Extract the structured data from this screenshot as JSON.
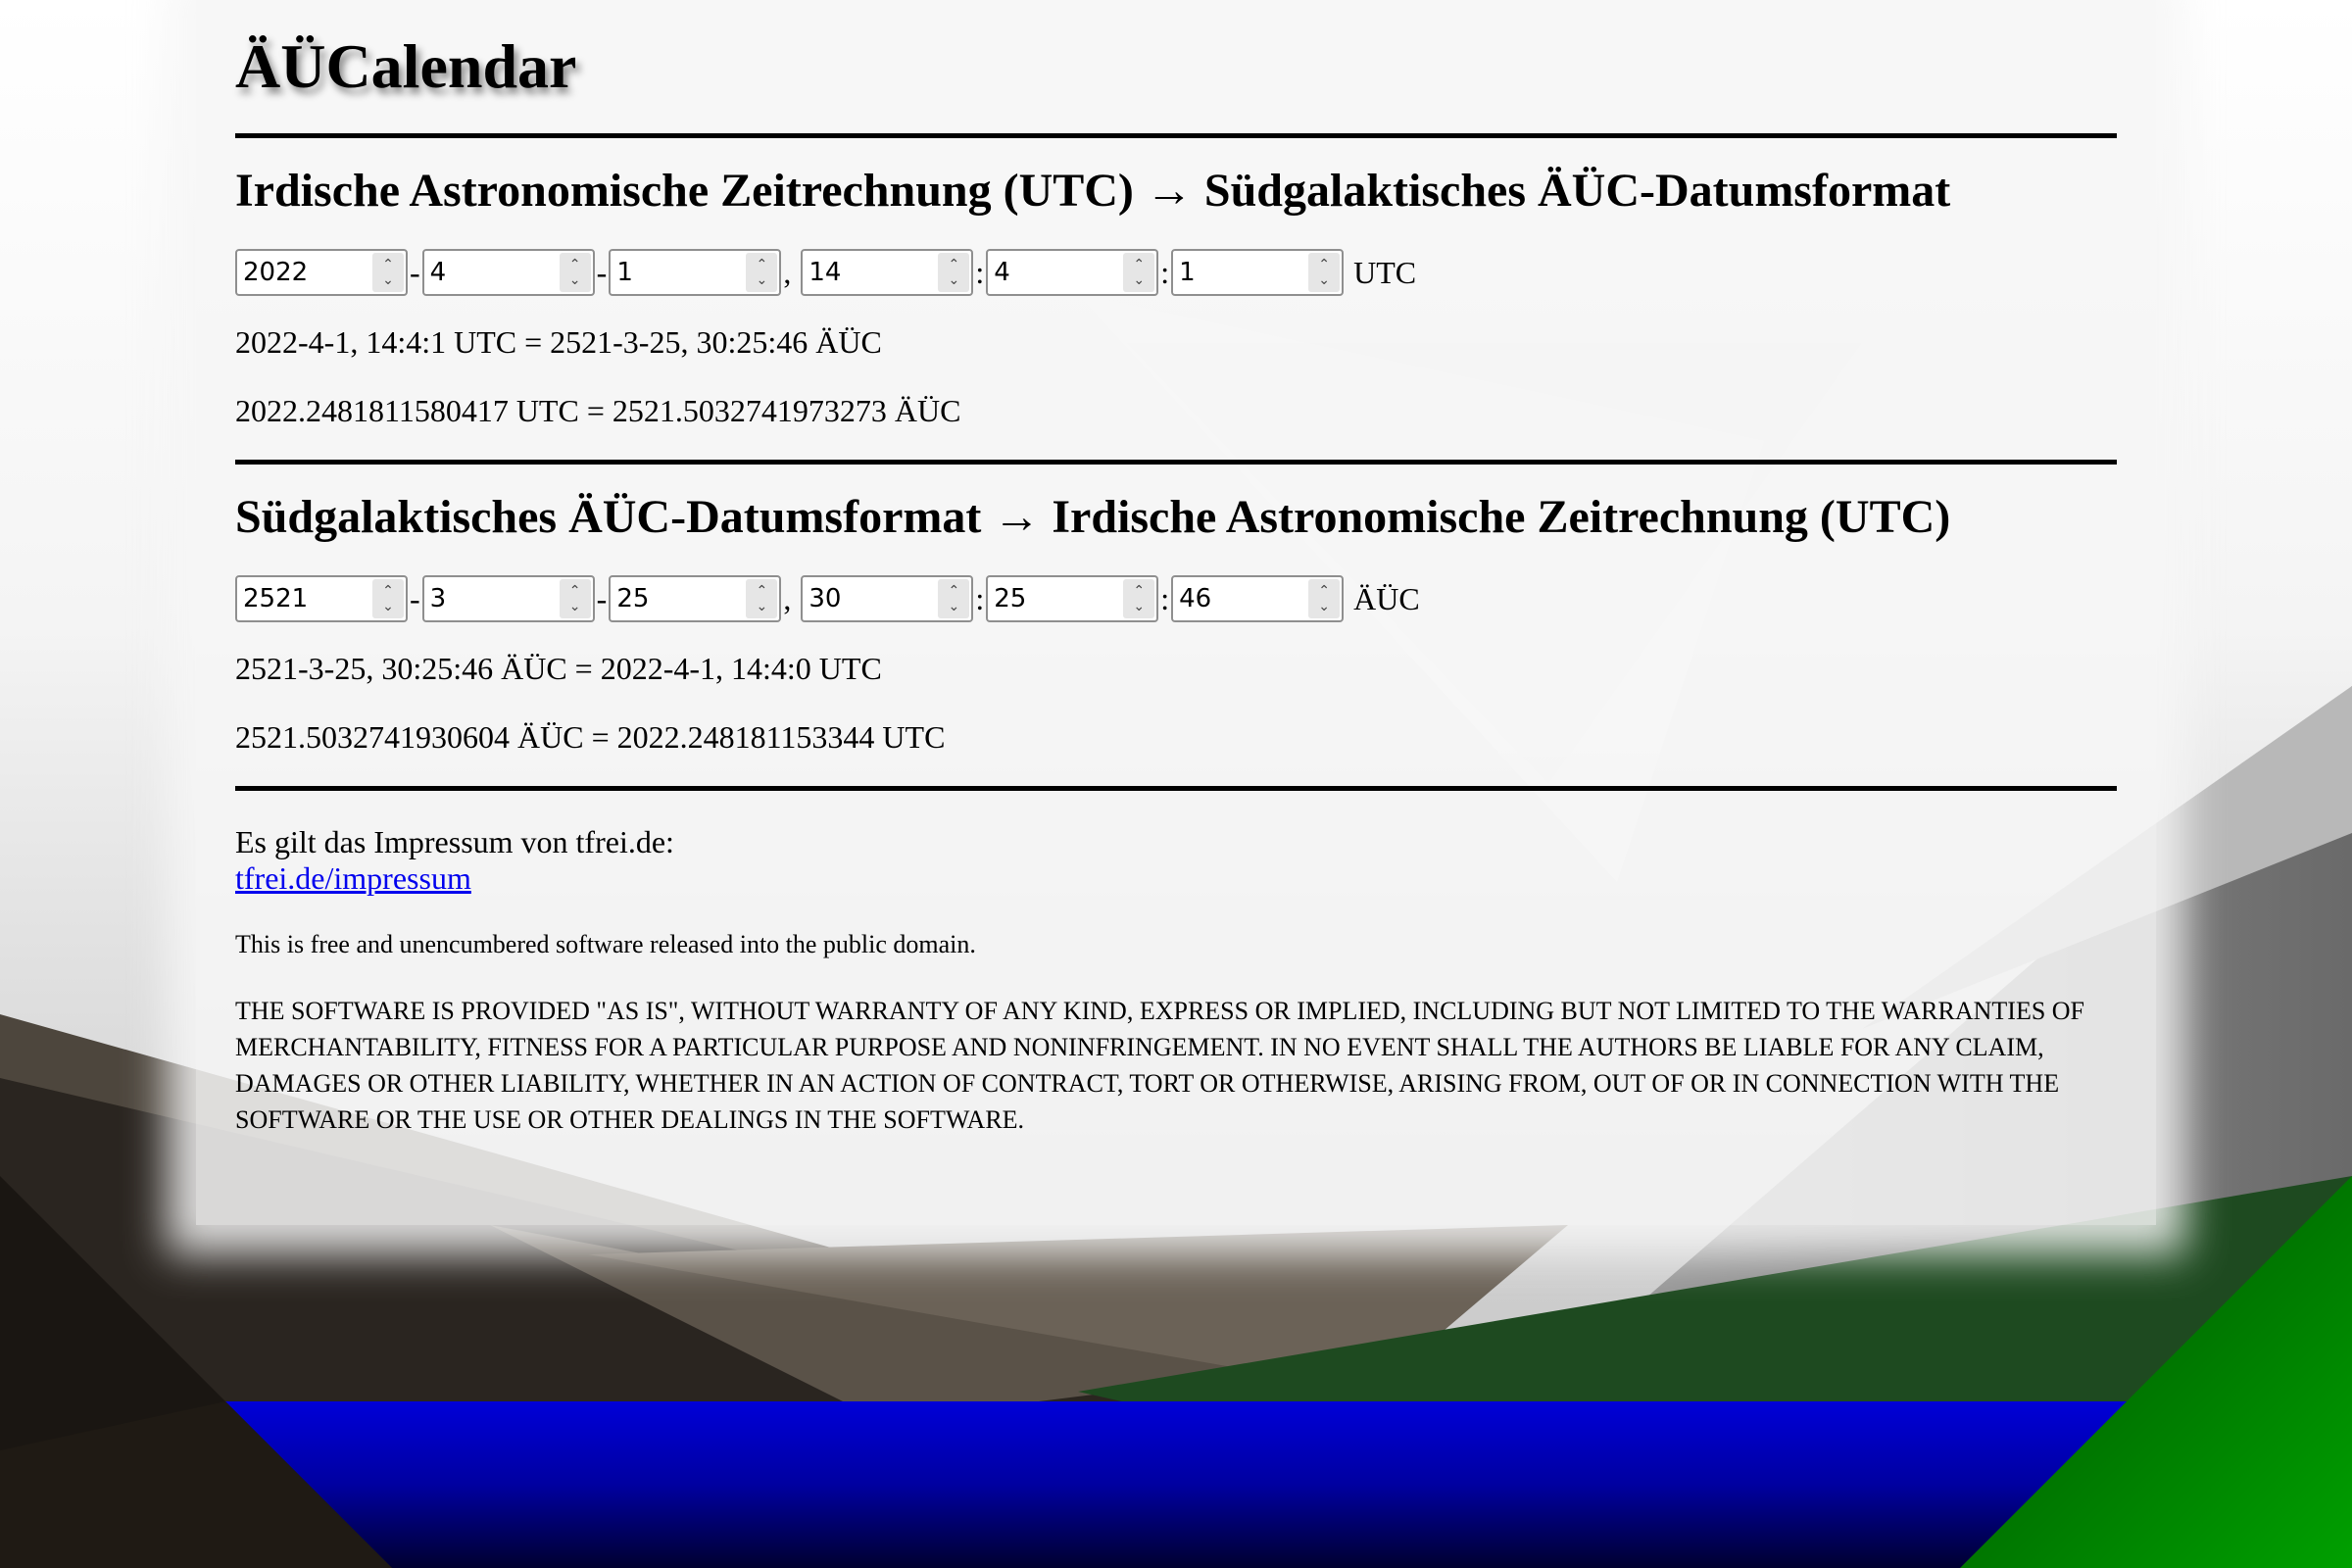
{
  "app": {
    "title": "ÄÜCalendar"
  },
  "utc_to_auc": {
    "heading": "Irdische Astronomische Zeitrechnung (UTC) → Südgalaktisches ÄÜC-Datumsformat",
    "fields": [
      "2022",
      "4",
      "1",
      "14",
      "4",
      "1"
    ],
    "separators": [
      "-",
      "-",
      ",",
      ":",
      ":"
    ],
    "unit": "UTC",
    "result_datetime": "2022-4-1, 14:4:1 UTC = 2521-3-25, 30:25:46 ÄÜC",
    "result_decimal": "2022.2481811580417 UTC = 2521.5032741973273 ÄÜC"
  },
  "auc_to_utc": {
    "heading": "Südgalaktisches ÄÜC-Datumsformat → Irdische Astronomische Zeitrechnung (UTC)",
    "fields": [
      "2521",
      "3",
      "25",
      "30",
      "25",
      "46"
    ],
    "separators": [
      "-",
      "-",
      ",",
      ":",
      ":"
    ],
    "unit": "ÄÜC",
    "result_datetime": "2521-3-25, 30:25:46 ÄÜC = 2022-4-1, 14:4:0 UTC",
    "result_decimal": "2521.5032741930604 ÄÜC = 2022.248181153344 UTC"
  },
  "footer": {
    "impressum_text": "Es gilt das Impressum von tfrei.de:",
    "impressum_link": "tfrei.de/impressum",
    "license_line": "This is free and unencumbered software released into the public domain.",
    "disclaimer": "THE SOFTWARE IS PROVIDED \"AS IS\", WITHOUT WARRANTY OF ANY KIND, EXPRESS OR IMPLIED, INCLUDING BUT NOT LIMITED TO THE WARRANTIES OF MERCHANTABILITY, FITNESS FOR A PARTICULAR PURPOSE AND NONINFRINGEMENT. IN NO EVENT SHALL THE AUTHORS BE LIABLE FOR ANY CLAIM, DAMAGES OR OTHER LIABILITY, WHETHER IN AN ACTION OF CONTRACT, TORT OR OTHERWISE, ARISING FROM, OUT OF OR IN CONNECTION WITH THE SOFTWARE OR THE USE OR OTHER DEALINGS IN THE SOFTWARE."
  },
  "colors": {
    "panel": "#f6f6f6",
    "link": "#0000ee",
    "water": "#0000cc",
    "green": "#1e4a20",
    "dark_brown": "#1f1a14"
  }
}
